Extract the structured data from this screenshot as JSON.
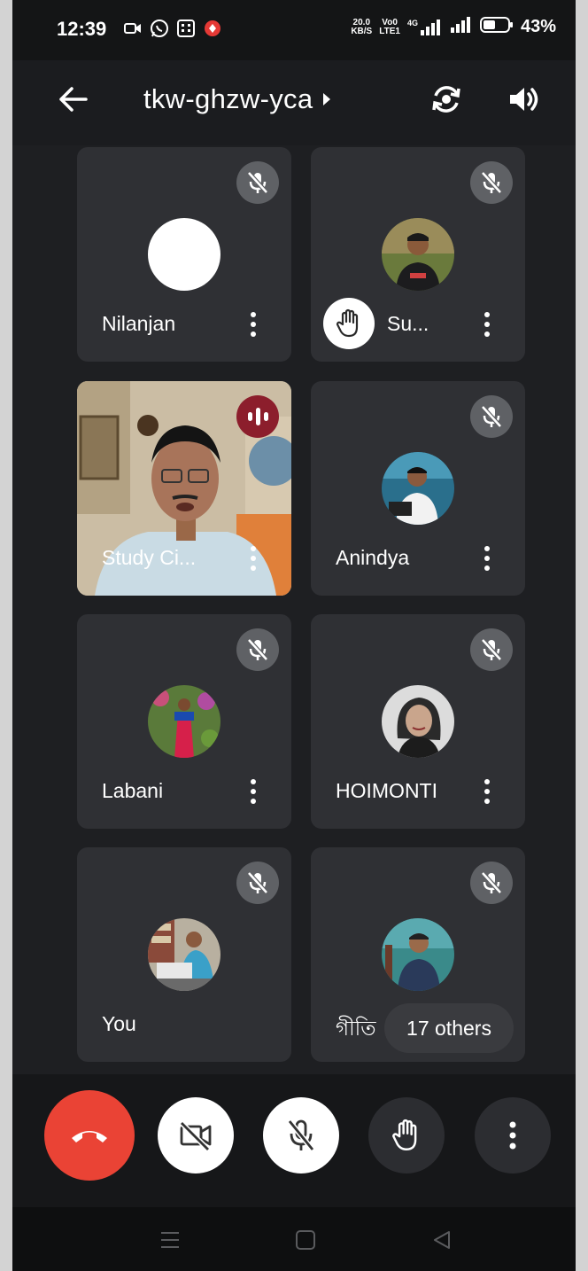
{
  "status_bar": {
    "time": "12:39",
    "net_speed_value": "20.0",
    "net_speed_unit": "KB/S",
    "sim_label_top": "Vo0",
    "sim_label_bottom": "LTE1",
    "network_type": "4G",
    "battery_percent": "43%"
  },
  "header": {
    "meeting_code": "tkw-ghzw-yca"
  },
  "tiles": [
    {
      "name": "Nilanjan",
      "muted": true
    },
    {
      "name": "Su...",
      "muted": true,
      "hand_raised": true
    },
    {
      "name": "Study Ci...",
      "muted": false,
      "speaking": true
    },
    {
      "name": "Anindya",
      "muted": true
    },
    {
      "name": "Labani",
      "muted": true
    },
    {
      "name": "HOIMONTI",
      "muted": true
    },
    {
      "name": "You",
      "muted": true
    },
    {
      "name": "গীতি",
      "muted": true
    }
  ],
  "others": {
    "label": "17 others"
  },
  "colors": {
    "end_call": "#ea4335",
    "background": "#1e1f22",
    "tile": "#2f3034",
    "speaking_badge": "#8c1e2c"
  }
}
